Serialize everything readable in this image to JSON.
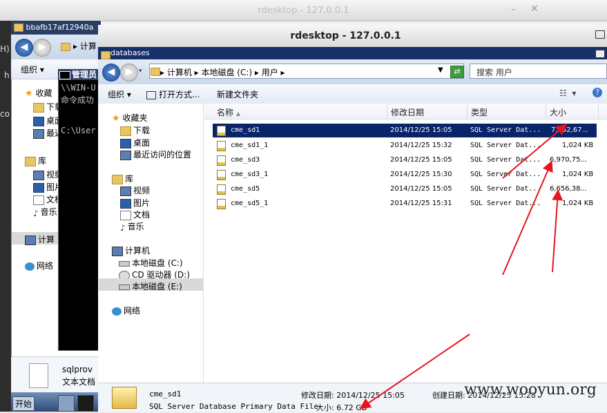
{
  "back_window": {
    "title": "rdesktop - 127.0.0.1",
    "min": "–",
    "close": "✕"
  },
  "left_explorer": {
    "tab_title": "bbafb17af12940a",
    "addr_text": "▸ 计算",
    "organize": "组织 ▾",
    "left_chars": {
      "h1": "H)",
      "h2": "h",
      "co": "co"
    },
    "favorites": "收藏",
    "fav_items": [
      "下载",
      "桌面",
      "最近"
    ],
    "library": "库",
    "lib_items": [
      "视频",
      "图片",
      "文档",
      "音乐"
    ],
    "computer": "计算",
    "network": "网络",
    "details_name": "sqlprov",
    "details_type": "文本文档",
    "start": "开始"
  },
  "cmd": {
    "title": "管理员",
    "line1": "\\\\WIN-U",
    "line2": "命令成功",
    "line3": "C:\\User"
  },
  "window": {
    "title": "rdesktop - 127.0.0.1",
    "tab": "databases"
  },
  "address": {
    "path": "▸ 计算机 ▸ 本地磁盘 (C:) ▸ 用户 ▸",
    "search_placeholder": "搜索 用户"
  },
  "toolbar": {
    "organize": "组织 ▾",
    "open_with": "打开方式...",
    "new_folder": "新建文件夹"
  },
  "sidebar": {
    "favorites": "收藏夹",
    "fav_items": [
      "下载",
      "桌面",
      "最近访问的位置"
    ],
    "library": "库",
    "lib_items": [
      "视频",
      "图片",
      "文档",
      "音乐"
    ],
    "computer": "计算机",
    "drives": [
      "本地磁盘 (C:)",
      "CD 驱动器 (D:)",
      "本地磁盘 (E:)"
    ],
    "network": "网络"
  },
  "columns": {
    "name": "名称",
    "date": "修改日期",
    "type": "类型",
    "size": "大小"
  },
  "files": [
    {
      "name": "cme_sd1",
      "date": "2014/12/25 15:05",
      "type": "SQL Server Dat...",
      "size": "7,052,67..."
    },
    {
      "name": "cme_sd1_1",
      "date": "2014/12/25 15:32",
      "type": "SQL Server Dat...",
      "size": "1,024 KB"
    },
    {
      "name": "cme_sd3",
      "date": "2014/12/25 15:05",
      "type": "SQL Server Dat...",
      "size": "6,970,75..."
    },
    {
      "name": "cme_sd3_1",
      "date": "2014/12/25 15:30",
      "type": "SQL Server Dat...",
      "size": "1,024 KB"
    },
    {
      "name": "cme_sd5",
      "date": "2014/12/25 15:05",
      "type": "SQL Server Dat...",
      "size": "6,656,38..."
    },
    {
      "name": "cme_sd5_1",
      "date": "2014/12/25 15:31",
      "type": "SQL Server Dat...",
      "size": "1,024 KB"
    }
  ],
  "details": {
    "name": "cme_sd1",
    "type": "SQL Server Database Primary Data File",
    "modified_label": "修改日期:",
    "modified": "2014/12/25 15:05",
    "size_label": "大小:",
    "size": "6.72 GB",
    "created_label": "创建日期:",
    "created": "2014/12/25 15:28"
  },
  "watermark": "www.wooyun.org",
  "colors": {
    "selection": "#0a246a",
    "arrow": "#e8141c",
    "titlebar_blue": "#17306a"
  }
}
